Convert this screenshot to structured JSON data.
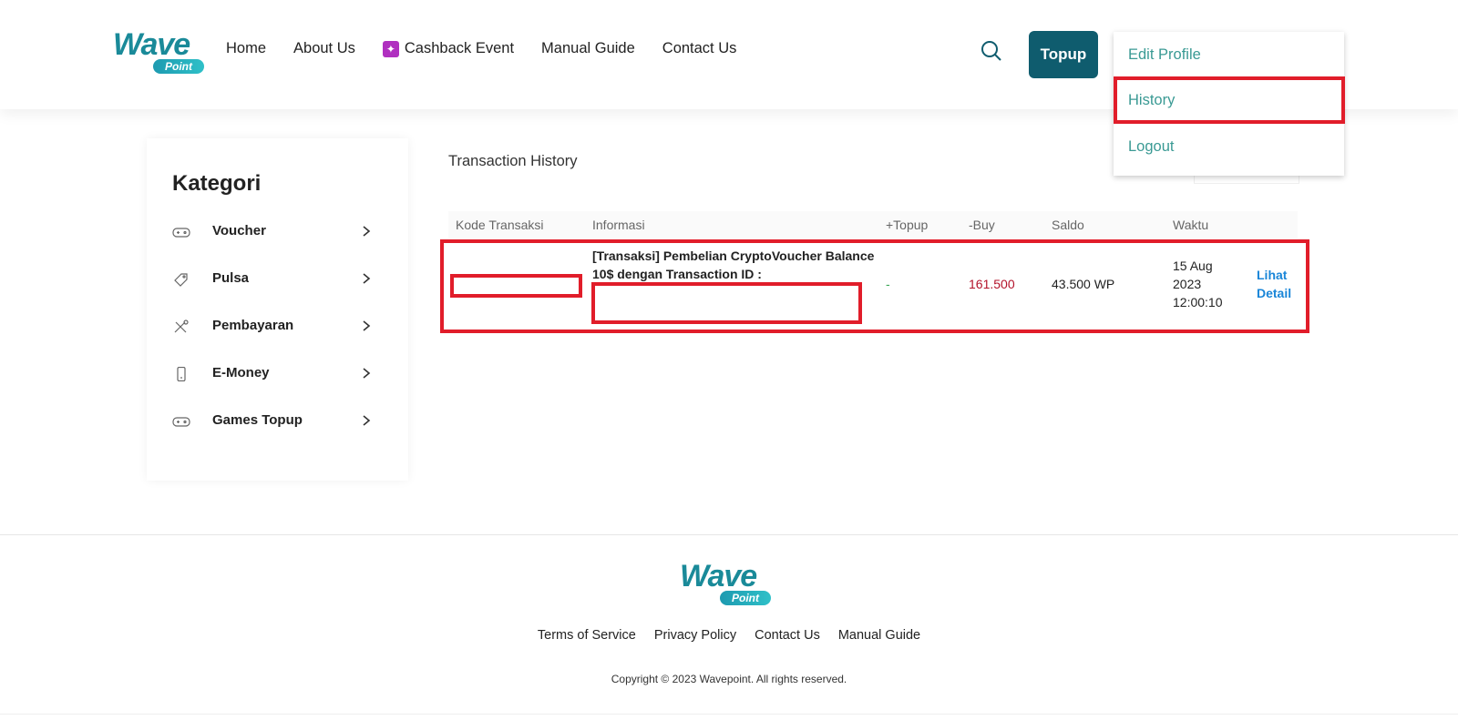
{
  "brand": {
    "logo_word": "Wave",
    "logo_sub": "Point"
  },
  "nav": {
    "home": "Home",
    "about": "About Us",
    "cashback": "Cashback Event",
    "manual": "Manual Guide",
    "contact": "Contact Us"
  },
  "header": {
    "topup_label": "Topup"
  },
  "dropdown": {
    "edit_profile": "Edit Profile",
    "history": "History",
    "logout": "Logout"
  },
  "sidebar": {
    "title": "Kategori",
    "items": [
      {
        "label": "Voucher",
        "icon": "gamepad-icon"
      },
      {
        "label": "Pulsa",
        "icon": "tag-icon"
      },
      {
        "label": "Pembayaran",
        "icon": "tools-icon"
      },
      {
        "label": "E-Money",
        "icon": "phone-icon"
      },
      {
        "label": "Games Topup",
        "icon": "gamepad-icon"
      }
    ]
  },
  "main": {
    "title": "Transaction History",
    "columns": [
      "Kode Transaksi",
      "Informasi",
      "+Topup",
      "-Buy",
      "Saldo",
      "Waktu"
    ],
    "rows": [
      {
        "kode": "",
        "informasi": "[Transaksi] Pembelian CryptoVoucher Balance 10$ dengan Transaction ID :",
        "topup": "-",
        "buy": "161.500",
        "saldo": "43.500 WP",
        "waktu": "15 Aug 2023 12:00:10",
        "action": "Lihat Detail"
      }
    ]
  },
  "footer": {
    "links": [
      "Terms of Service",
      "Privacy Policy",
      "Contact Us",
      "Manual Guide"
    ],
    "copyright": "Copyright © 2023 Wavepoint. All rights reserved."
  },
  "colors": {
    "primary": "#0f5c6e",
    "teal_text": "#3a9a94",
    "highlight": "#e11d2a",
    "buy_red": "#b3122a",
    "topup_green": "#3aa655",
    "link_blue": "#1a86d8"
  }
}
